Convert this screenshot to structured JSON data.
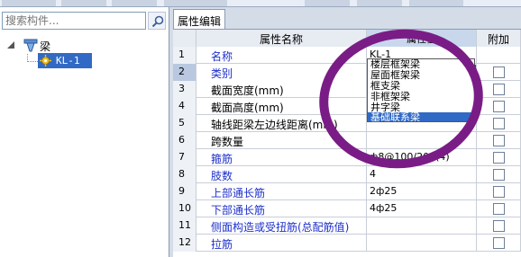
{
  "search": {
    "placeholder": "搜索构件..."
  },
  "tree": {
    "root_label": "梁",
    "child_label": "KL-1"
  },
  "tab": {
    "label": "属性编辑"
  },
  "grid": {
    "headers": {
      "name": "属性名称",
      "value": "属性值",
      "add": "附加"
    },
    "rows": [
      {
        "num": "1",
        "name": "名称",
        "value": "KL-1",
        "blue": true,
        "checkbox": false
      },
      {
        "num": "2",
        "name": "类别",
        "value": "基础联系梁",
        "blue": true,
        "checkbox": true
      },
      {
        "num": "3",
        "name": "截面宽度(mm)",
        "value": "",
        "blue": false,
        "checkbox": true
      },
      {
        "num": "4",
        "name": "截面高度(mm)",
        "value": "",
        "blue": false,
        "checkbox": true
      },
      {
        "num": "5",
        "name": "轴线距梁左边线距离(mm)",
        "value": "",
        "blue": false,
        "checkbox": true
      },
      {
        "num": "6",
        "name": "跨数量",
        "value": "",
        "blue": false,
        "checkbox": true
      },
      {
        "num": "7",
        "name": "箍筋",
        "value": "ф8@100/200(4)",
        "blue": true,
        "checkbox": true
      },
      {
        "num": "8",
        "name": "肢数",
        "value": "4",
        "blue": true,
        "checkbox": true
      },
      {
        "num": "9",
        "name": "上部通长筋",
        "value": "2ф25",
        "blue": true,
        "checkbox": true
      },
      {
        "num": "10",
        "name": "下部通长筋",
        "value": "4ф25",
        "blue": true,
        "checkbox": true
      },
      {
        "num": "11",
        "name": "侧面构造或受扭筋(总配筋值)",
        "value": "",
        "blue": true,
        "checkbox": true
      },
      {
        "num": "12",
        "name": "拉筋",
        "value": "",
        "blue": true,
        "checkbox": true
      }
    ],
    "dropdown_options": [
      "楼层框架梁",
      "屋面框架梁",
      "框支梁",
      "非框架梁",
      "井字梁",
      "基础联系梁"
    ],
    "dropdown_selected": "基础联系梁"
  },
  "colors": {
    "accent": "#316ac5",
    "annotation_circle": "#7a1c86",
    "blue_text": "#1d2fc9"
  }
}
